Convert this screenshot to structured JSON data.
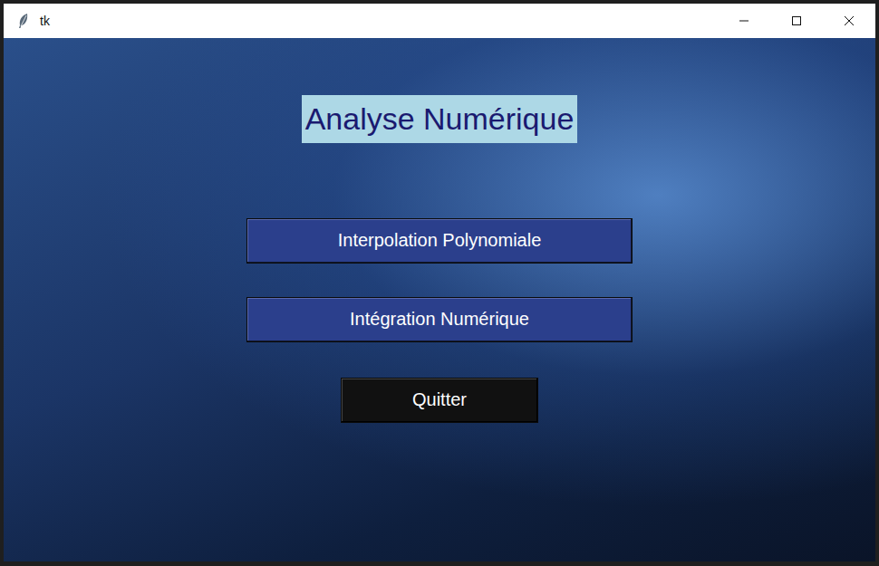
{
  "window": {
    "title": "tk"
  },
  "heading": "Analyse Numérique",
  "buttons": [
    {
      "label": "Interpolation Polynomiale",
      "kind": "menu"
    },
    {
      "label": "Intégration Numérique",
      "kind": "menu"
    },
    {
      "label": "Quitter",
      "kind": "quit"
    }
  ]
}
